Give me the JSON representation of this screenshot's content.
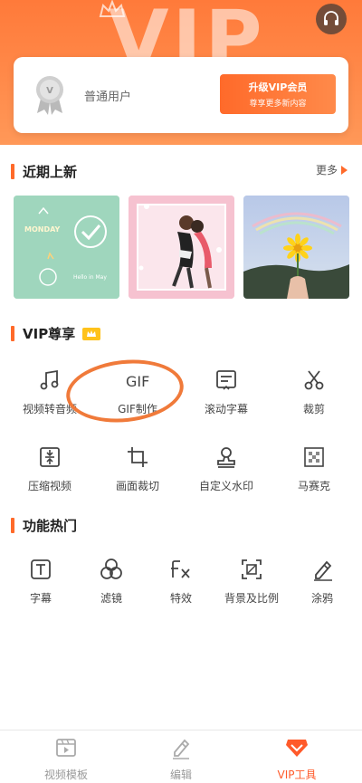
{
  "header": {
    "hero_word": "VIP",
    "member": {
      "user_type": "普通用户",
      "upgrade_line1": "升级VIP会员",
      "upgrade_line2": "尊享更多新内容"
    }
  },
  "recent": {
    "title": "近期上新",
    "more": "更多",
    "thumbs": [
      {
        "text1": "MONDAY",
        "text2": "Hello in May"
      },
      {
        "text1": ""
      },
      {
        "text1": ""
      }
    ]
  },
  "vip": {
    "title": "VIP尊享",
    "tools": [
      {
        "label": "视频转音频",
        "icon": "music-note-icon"
      },
      {
        "label": "GIF制作",
        "icon": "gif-icon"
      },
      {
        "label": "滚动字幕",
        "icon": "scroll-subtitle-icon"
      },
      {
        "label": "裁剪",
        "icon": "scissors-icon"
      },
      {
        "label": "压缩视频",
        "icon": "compress-icon"
      },
      {
        "label": "画面裁切",
        "icon": "crop-icon"
      },
      {
        "label": "自定义水印",
        "icon": "stamp-icon"
      },
      {
        "label": "马赛克",
        "icon": "mosaic-icon"
      }
    ]
  },
  "hot": {
    "title": "功能热门",
    "tools": [
      {
        "label": "字幕",
        "icon": "text-icon"
      },
      {
        "label": "滤镜",
        "icon": "filter-icon"
      },
      {
        "label": "特效",
        "icon": "fx-icon"
      },
      {
        "label": "背景及比例",
        "icon": "aspect-ratio-icon"
      },
      {
        "label": "涂鸦",
        "icon": "doodle-icon"
      }
    ]
  },
  "tabbar": {
    "tabs": [
      {
        "label": "视频模板",
        "icon": "video-template-icon"
      },
      {
        "label": "编辑",
        "icon": "edit-icon"
      },
      {
        "label": "VIP工具",
        "icon": "vip-tools-icon"
      }
    ]
  },
  "colors": {
    "accent": "#ff6a2a",
    "hero": "#ff8a4a"
  }
}
